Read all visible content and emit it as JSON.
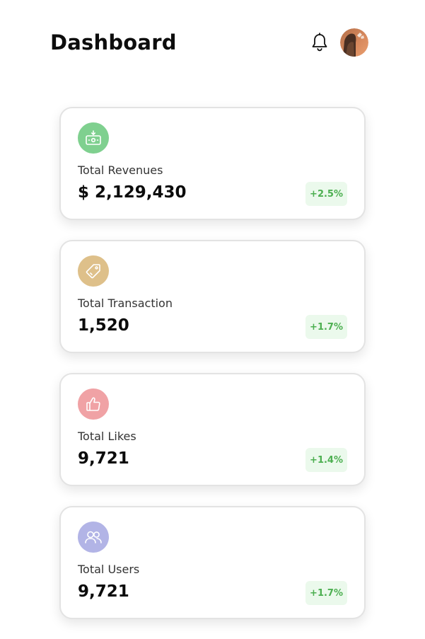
{
  "header": {
    "title": "Dashboard",
    "notification_icon": "bell-icon",
    "avatar_icon": "user-avatar"
  },
  "cards": [
    {
      "icon": "money-icon",
      "icon_bg": "#7fd08f",
      "label": "Total Revenues",
      "value": "$ 2,129,430",
      "change": "+2.5%"
    },
    {
      "icon": "tag-icon",
      "icon_bg": "#dec08a",
      "label": "Total Transaction",
      "value": "1,520",
      "change": "+1.7%"
    },
    {
      "icon": "thumbs-up-icon",
      "icon_bg": "#f0a2a5",
      "label": "Total Likes",
      "value": "9,721",
      "change": "+1.4%"
    },
    {
      "icon": "users-icon",
      "icon_bg": "#b2b4e6",
      "label": "Total Users",
      "value": "9,721",
      "change": "+1.7%"
    }
  ],
  "colors": {
    "badge_bg": "#ebf9ec",
    "badge_text": "#4caf50",
    "card_border": "#e3e3e3"
  }
}
